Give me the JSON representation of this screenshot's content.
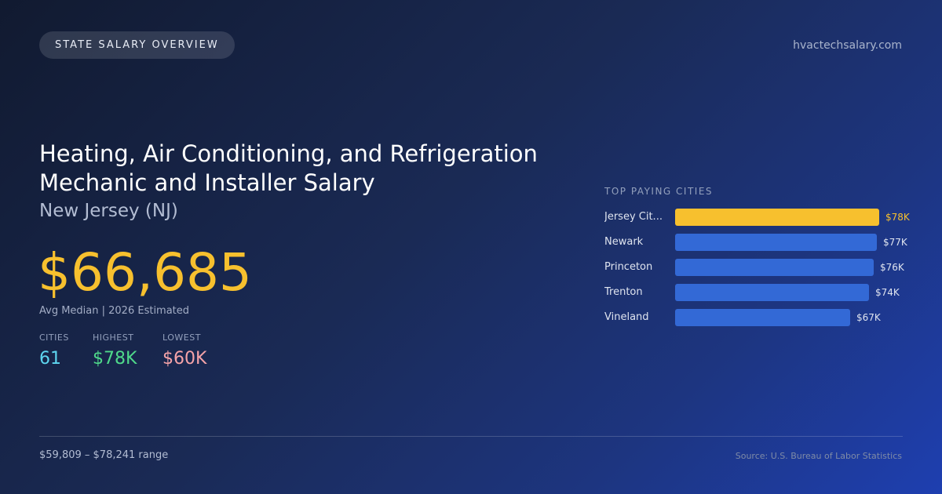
{
  "badge": "STATE SALARY OVERVIEW",
  "site": "hvactechsalary.com",
  "title": "Heating, Air Conditioning, and Refrigeration Mechanic and Installer Salary",
  "state": "New Jersey (NJ)",
  "amount": "$66,685",
  "subline": "Avg Median | 2026 Estimated",
  "stats": {
    "cities": {
      "label": "CITIES",
      "value": "61"
    },
    "highest": {
      "label": "HIGHEST",
      "value": "$78K"
    },
    "lowest": {
      "label": "LOWEST",
      "value": "$60K"
    }
  },
  "range": "$59,809 – $78,241 range",
  "source": "Source: U.S. Bureau of Labor Statistics",
  "colors": {
    "accent": "#f7c02e",
    "bar": "#3369d6"
  },
  "chart_data": {
    "type": "bar",
    "orientation": "horizontal",
    "title": "TOP PAYING CITIES",
    "categories": [
      "Jersey Cit...",
      "Newark",
      "Princeton",
      "Trenton",
      "Vineland"
    ],
    "values": [
      78,
      77,
      76,
      74,
      67
    ],
    "value_labels": [
      "$78K",
      "$77K",
      "$76K",
      "$74K",
      "$67K"
    ],
    "highlight_index": 0
  }
}
